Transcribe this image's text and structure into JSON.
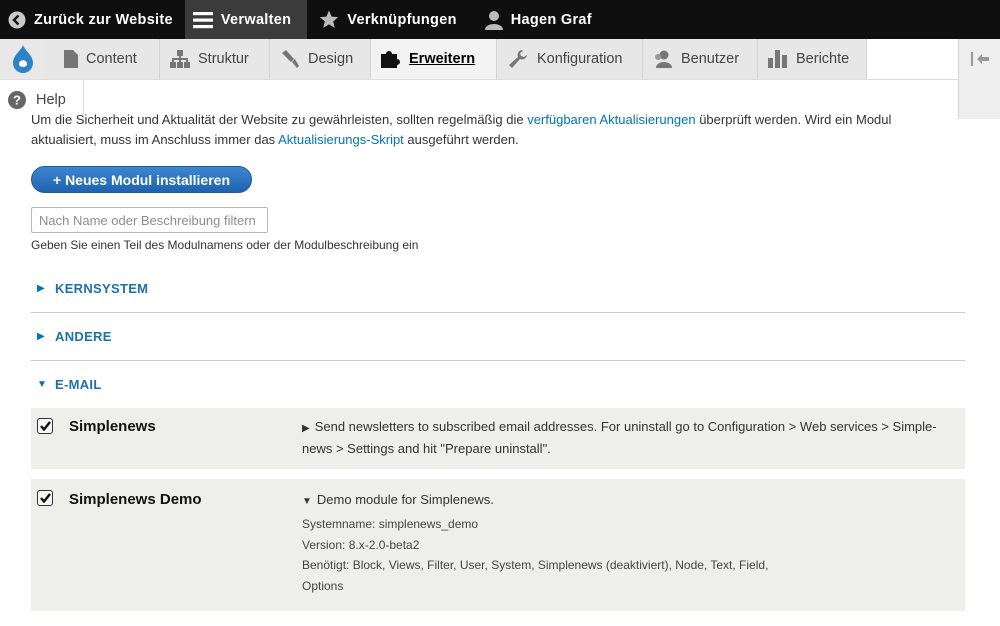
{
  "toolbar": {
    "back": "Zurück zur Website",
    "manage": "Verwalten",
    "shortcuts": "Verknüpfungen",
    "user": "Hagen Graf"
  },
  "tray": {
    "tabs": [
      "Content",
      "Struktur",
      "Design",
      "Erweitern",
      "Konfiguration",
      "Benutzer",
      "Berichte"
    ],
    "help": "Help"
  },
  "intro": {
    "line1_a": "Um die Sicherheit und Aktualität der Website zu gewährleisten, sollten regelmäßig die ",
    "line1_link": "verfügbaren Aktualisierungen",
    "line1_b": " überprüft werden. Wird ein Modul",
    "line2_a": "aktualisiert, muss im Anschluss immer das ",
    "line2_link": "Aktualisierungs-Skript",
    "line2_b": " ausgeführt werden."
  },
  "install_button": "+ Neues Modul installieren",
  "filter": {
    "placeholder": "Nach Name oder Beschreibung filtern",
    "help": "Geben Sie einen Teil des Modulnamens oder der Modulbeschreibung ein"
  },
  "sections": [
    {
      "label": "KERNSYSTEM",
      "expanded": false
    },
    {
      "label": "ANDERE",
      "expanded": false
    },
    {
      "label": "E-MAIL",
      "expanded": true
    }
  ],
  "modules": [
    {
      "name": "Simplenews",
      "checked": true,
      "desc_line1": "Send newsletters to subscribed email addresses. For uninstall go to Configuration > Web services > Simple-",
      "desc_line2": "news > Settings and hit \"Prepare uninstall\"."
    },
    {
      "name": "Simplenews Demo",
      "checked": true,
      "desc": "Demo module for Simplenews.",
      "machine_name": "Systemname: simplenews_demo",
      "version": "Version: 8.x-2.0-beta2",
      "requires_line1": "Benötigt: Block, Views, Filter, User, System, Simplenews (deaktiviert), Node, Text, Field,",
      "requires_line2": "Options"
    }
  ],
  "colors": {
    "accent": "#0074bd",
    "toolbar": "#0f0f0f"
  }
}
